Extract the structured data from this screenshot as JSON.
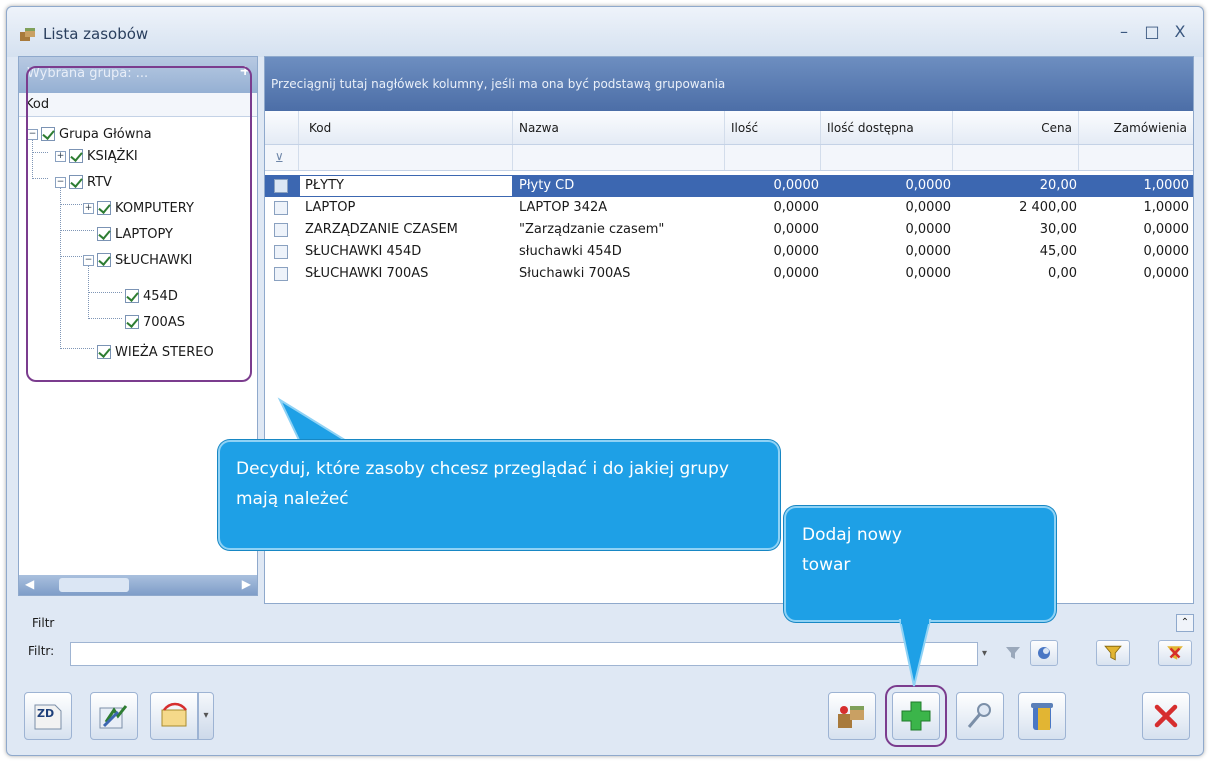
{
  "window": {
    "title": "Lista zasobów",
    "controls": [
      "–",
      "□",
      "X"
    ]
  },
  "tree": {
    "group_placeholder": "Wybrana grupa: ...",
    "group_add": "+",
    "column_header": "Kod",
    "nodes": [
      {
        "label": "Grupa Główna",
        "checked": true,
        "expander": "minus"
      },
      {
        "label": "KSIĄŻKI",
        "checked": true,
        "expander": "plus"
      },
      {
        "label": "RTV",
        "checked": true,
        "expander": "minus"
      },
      {
        "label": "KOMPUTERY",
        "checked": true,
        "expander": "plus"
      },
      {
        "label": "LAPTOPY",
        "checked": true,
        "expander": "none"
      },
      {
        "label": "SŁUCHAWKI",
        "checked": true,
        "expander": "minus"
      },
      {
        "label": "454D",
        "checked": true,
        "expander": "none"
      },
      {
        "label": "700AS",
        "checked": true,
        "expander": "none"
      },
      {
        "label": "WIEŻA STEREO",
        "checked": true,
        "expander": "none"
      }
    ]
  },
  "grid": {
    "group_by_hint": "Przeciągnij tutaj nagłówek kolumny, jeśli ma ona być podstawą grupowania",
    "columns": [
      "Kod",
      "Nazwa",
      "Ilość",
      "Ilość dostępna",
      "Cena",
      "Zamówienia"
    ],
    "rows": [
      {
        "kod": "PŁYTY",
        "nazwa": "Płyty CD",
        "ilosc": "0,0000",
        "dostepna": "0,0000",
        "cena": "20,00",
        "zamowienia": "1,0000",
        "selected": true
      },
      {
        "kod": "LAPTOP",
        "nazwa": "LAPTOP 342A",
        "ilosc": "0,0000",
        "dostepna": "0,0000",
        "cena": "2 400,00",
        "zamowienia": "1,0000",
        "selected": false
      },
      {
        "kod": "ZARZĄDZANIE CZASEM",
        "nazwa": "\"Zarządzanie czasem\"",
        "ilosc": "0,0000",
        "dostepna": "0,0000",
        "cena": "30,00",
        "zamowienia": "0,0000",
        "selected": false
      },
      {
        "kod": "SŁUCHAWKI 454D",
        "nazwa": "słuchawki 454D",
        "ilosc": "0,0000",
        "dostepna": "0,0000",
        "cena": "45,00",
        "zamowienia": "0,0000",
        "selected": false
      },
      {
        "kod": "SŁUCHAWKI 700AS",
        "nazwa": "Słuchawki 700AS",
        "ilosc": "0,0000",
        "dostepna": "0,0000",
        "cena": "0,00",
        "zamowienia": "0,0000",
        "selected": false
      }
    ]
  },
  "filter": {
    "section_label": "Filtr",
    "field_label": "Filtr:",
    "value": ""
  },
  "toolbar": {
    "zd_label": "ZD"
  },
  "callouts": {
    "groups": "Decyduj, które zasoby chcesz przeglądać i do jakiej grupy mają należeć",
    "add": "Dodaj nowy towar"
  },
  "colors": {
    "selection": "#3c67b1",
    "callout": "#1ea0e6",
    "highlight": "#7b3c8e"
  },
  "icons": [
    "resources-icon",
    "funnel-icon",
    "add-plus-icon",
    "close-x-icon",
    "search-icon",
    "trash-icon"
  ]
}
